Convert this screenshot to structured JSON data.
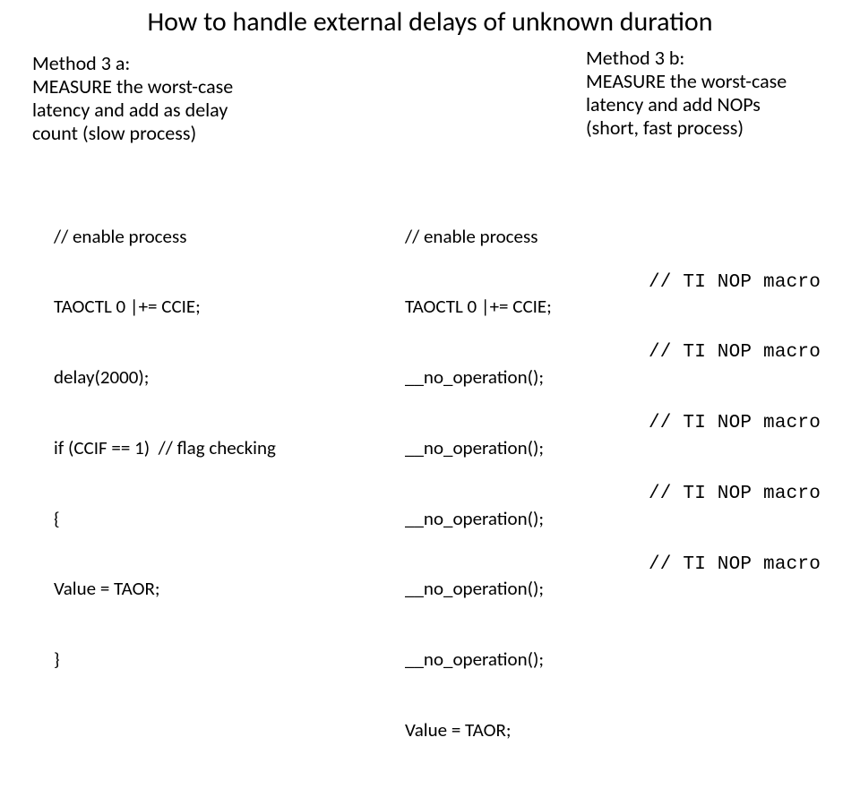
{
  "title": "How to handle external delays of unknown duration",
  "methodA": {
    "heading": "Method 3 a:",
    "line1": "MEASURE the worst-case",
    "line2": "latency and add as delay",
    "line3": "count (slow process)"
  },
  "methodB": {
    "heading": "Method 3 b:",
    "line1": "MEASURE the worst-case",
    "line2": "latency and add NOPs",
    "line3": "(short, fast process)"
  },
  "codeA": {
    "l1": "// enable process",
    "l2": "TAOCTL 0 |+= CCIE;",
    "l3": "delay(2000);",
    "l4": "if (CCIF == 1)  // flag checking",
    "l5": "{",
    "l6": "Value = TAOR;",
    "l7": "}"
  },
  "codeB": {
    "l1": "// enable process",
    "l2": "TAOCTL 0 |+= CCIE;",
    "l3": "__no_operation();",
    "l4": "__no_operation();",
    "l5": "__no_operation();",
    "l6": "__no_operation();",
    "l7": "__no_operation();",
    "l8": "Value = TAOR;"
  },
  "codeBComments": {
    "c1": "// TI NOP macro",
    "c2": "// TI NOP macro",
    "c3": "// TI NOP macro",
    "c4": "// TI NOP macro",
    "c5": "// TI NOP macro"
  }
}
